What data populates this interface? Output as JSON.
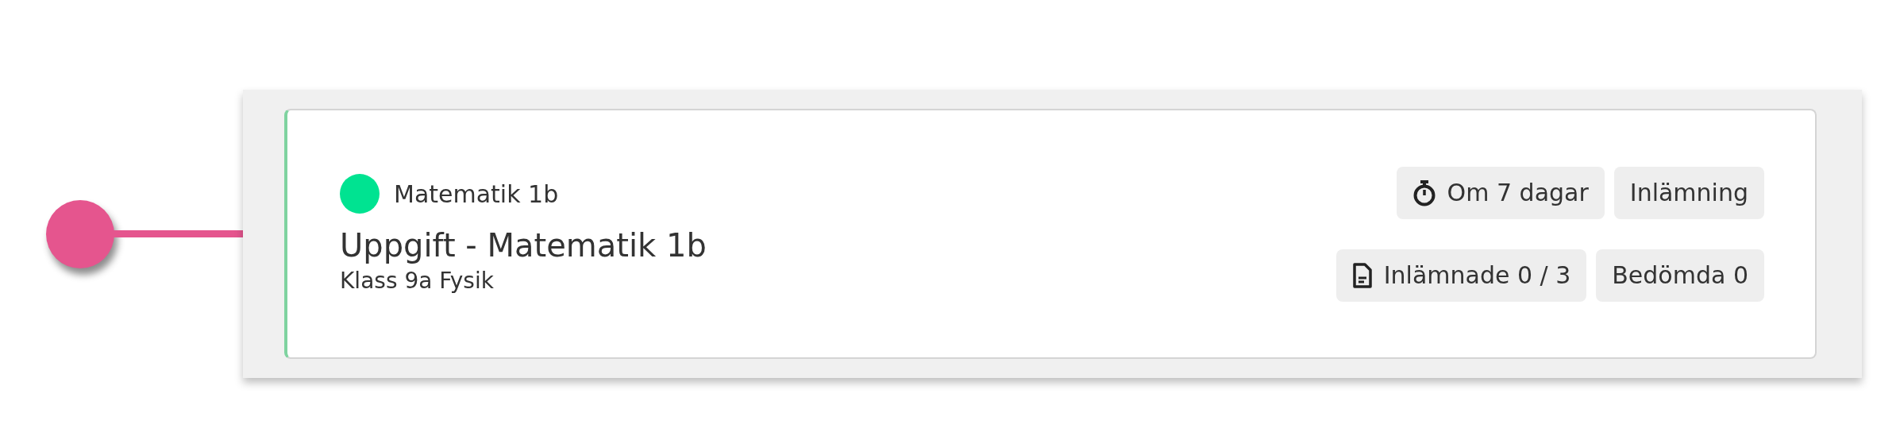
{
  "card": {
    "subject": {
      "name": "Matematik 1b",
      "color": "#00e391"
    },
    "title": "Uppgift - Matematik 1b",
    "subtitle": "Klass 9a Fysik",
    "badge_rows": [
      [
        {
          "kind": "deadline",
          "label": "Om 7 dagar"
        },
        {
          "kind": "plain",
          "label": "Inlämning"
        }
      ],
      [
        {
          "kind": "submissions",
          "label": "Inlämnade 0 / 3"
        },
        {
          "kind": "plain",
          "label": "Bedömda 0"
        }
      ]
    ]
  }
}
